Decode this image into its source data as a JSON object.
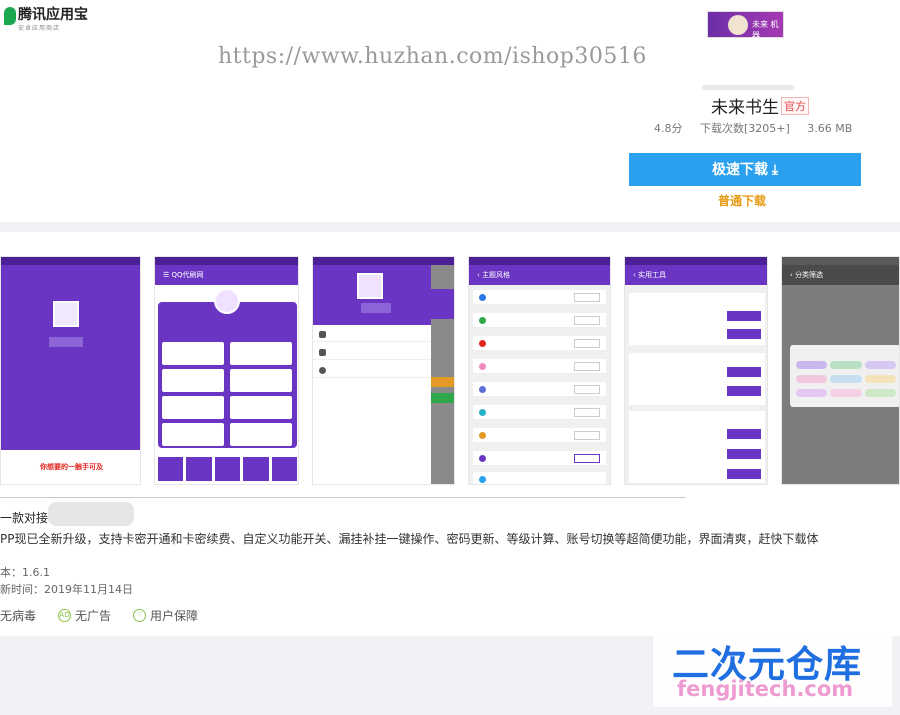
{
  "header": {
    "store_name": "腾讯应用宝",
    "store_sub": "安卓应用商店",
    "watermark": "https://www.huzhan.com/ishop30516"
  },
  "app": {
    "name": "未来书生",
    "official_badge": "官方",
    "rating": "4.8分",
    "downloads": "下载次数[3205+]",
    "size": "3.66 MB",
    "fast_download": "极速下载 ⤓",
    "normal_download": "普通下载",
    "icon_text": "未来  机器"
  },
  "screenshots": {
    "s1_caption": "你想要的一触手可及",
    "s2_title": "QQ代刷网",
    "s4_title": "主题风格",
    "s5_title": "实用工具",
    "s6_title": "分类筛选"
  },
  "description": {
    "title": "一款对接            站的软件",
    "body": "PP现已全新升级，支持卡密开通和卡密续费、自定义功能开关、漏挂补挂一键操作、密码更新、等级计算、账号切换等超简便功能，界面清爽，赶快下载体",
    "version": "本：1.6.1",
    "update_time": "新时间：2019年11月14日"
  },
  "badges": [
    {
      "label": "无病毒"
    },
    {
      "label": "无广告"
    },
    {
      "label": "用户保障"
    }
  ],
  "corner_watermark": {
    "title": "二次元仓库",
    "url": "fengjitech.com"
  }
}
